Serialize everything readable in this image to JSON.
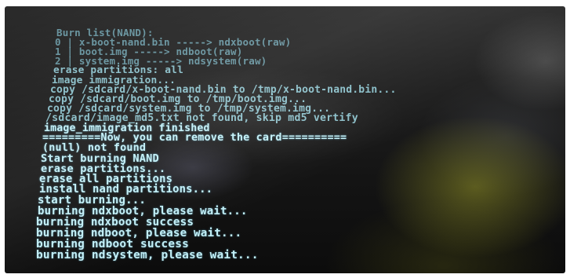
{
  "console": {
    "lines": [
      "Burn list(NAND):",
      "0 | x-boot-nand.bin -----> ndxboot(raw)",
      "1 | boot.img -----> ndboot(raw)",
      "2 | system.img -----> ndsystem(raw)",
      "erase partitions: all",
      "image immigration...",
      "copy /sdcard/x-boot-nand.bin to /tmp/x-boot-nand.bin...",
      "copy /sdcard/boot.img to /tmp/boot.img...",
      "copy /sdcard/system.img to /tmp/system.img...",
      "/sdcard/image_md5.txt not found, skip md5 vertify",
      "image_immigration finished",
      "=========Now, you can remove the card==========",
      "(null) not found",
      "Start burning NAND",
      "erase partitions...",
      "erase all partitions",
      "install nand partitions...",
      "start burning...",
      "burning ndxboot, please wait...",
      "burning ndxboot success",
      "burning ndboot, please wait...",
      "burning ndboot success",
      "burning ndsystem, please wait..."
    ]
  },
  "colors": {
    "terminal_text": "#c8f7ff",
    "screen_background": "#141414"
  }
}
